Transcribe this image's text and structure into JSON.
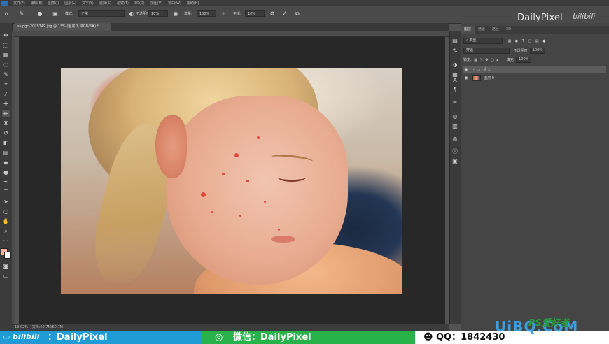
{
  "menubar": {
    "items": [
      "文件(F)",
      "编辑(E)",
      "图像(I)",
      "图层(L)",
      "文字(Y)",
      "选择(S)",
      "滤镜(T)",
      "3D(D)",
      "视图(V)",
      "窗口(W)",
      "帮助(H)"
    ]
  },
  "options": {
    "mode_label": "模式:",
    "mode_value": "正常",
    "opacity_label": "不透明度:",
    "opacity_value": "10%",
    "flow_label": "流量:",
    "flow_value": "100%",
    "smooth_label": "平滑:",
    "smooth_value": "10%"
  },
  "document": {
    "tab_title": "ss-pgc-2005349.jpg @ 13% (图层 1, RGB/8#) *",
    "status_zoom": "13.02%",
    "status_doc": "文档:60.7M/60.7M"
  },
  "panel": {
    "tabs": [
      "图层",
      "通道",
      "路径",
      "3D"
    ],
    "kind_label": "类型",
    "blend_mode": "穿透",
    "opacity_label": "不透明度:",
    "opacity_value": "100%",
    "lock_label": "锁定:",
    "fill_label": "填充:",
    "fill_value": "100%",
    "layers": [
      {
        "name": "组 1",
        "type": "group",
        "selected": true
      },
      {
        "name": "图层 0",
        "type": "image",
        "selected": false
      }
    ]
  },
  "watermark": {
    "name": "DailyPixel",
    "bili": "bilibili"
  },
  "banner": {
    "blue_prefix": "bilibili",
    "blue_text": "：DailyPixel",
    "green_text": "微信：DailyPixel",
    "white_text": "QQ：1842430",
    "site_big": "UiBQ.CoM",
    "site_small": "PS爱好者"
  },
  "colors": {
    "banner_blue": "#1f9bd5",
    "banner_green": "#27b24a",
    "site_blue": "#3aa0e0"
  },
  "icons": {
    "tools": [
      "move-icon",
      "marquee-icon",
      "artboard-icon",
      "lasso-icon",
      "quick-select-icon",
      "crop-icon",
      "eyedropper-icon",
      "healing-icon",
      "brush-icon",
      "stamp-icon",
      "history-brush-icon",
      "eraser-icon",
      "gradient-icon",
      "blur-icon",
      "dodge-icon",
      "pen-icon",
      "type-icon",
      "path-select-icon",
      "shape-icon",
      "hand-icon",
      "zoom-icon"
    ]
  }
}
